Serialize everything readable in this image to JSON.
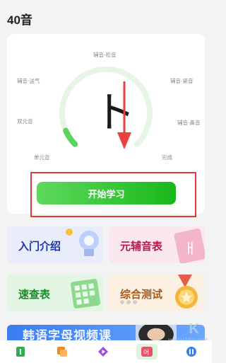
{
  "header": {
    "title": "40音"
  },
  "gauge": {
    "character": "ト",
    "progress": 0.08,
    "labels": {
      "top": "辅音-松音",
      "upper_left": "辅音-送气",
      "upper_right": "辅音-紧音",
      "mid_left": "双元音",
      "mid_right": "辅音-鼻音",
      "lower_left": "单元音",
      "lower_right": "完成"
    }
  },
  "start_button": {
    "label": "开始学习"
  },
  "tiles": [
    {
      "label": "入门介绍",
      "icon": "lightbulb-icon"
    },
    {
      "label": "元辅音表",
      "icon": "hangul-icon"
    },
    {
      "label": "速查表",
      "icon": "calendar-grid-icon"
    },
    {
      "label": "综合测试",
      "icon": "medal-icon"
    }
  ],
  "banner": {
    "text": "韩语字母视频课"
  },
  "watermark": {
    "site": "www.kkx.net",
    "logo": "KK下载"
  },
  "colors": {
    "accent": "#19b819",
    "highlight": "#e23a3a"
  },
  "tabbar": [
    {
      "icon": "book-icon",
      "color": "#2fae4f"
    },
    {
      "icon": "cards-icon",
      "color": "#f08a24"
    },
    {
      "icon": "play-icon",
      "color": "#9b4dde"
    },
    {
      "icon": "korean-letter-icon",
      "color": "#e9506a",
      "active": true
    },
    {
      "icon": "pause-icon",
      "color": "#3a7ff0"
    }
  ]
}
